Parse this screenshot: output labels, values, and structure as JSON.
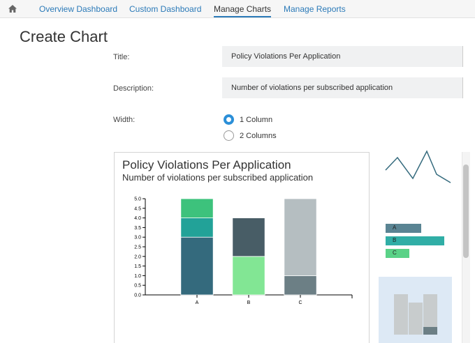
{
  "nav": {
    "home_icon": "home-icon",
    "links": [
      {
        "label": "Overview Dashboard",
        "active": false
      },
      {
        "label": "Custom Dashboard",
        "active": false
      },
      {
        "label": "Manage Charts",
        "active": true
      },
      {
        "label": "Manage Reports",
        "active": false
      }
    ]
  },
  "page_title": "Create Chart",
  "form": {
    "title_label": "Title:",
    "title_value": "Policy Violations Per Application",
    "description_label": "Description:",
    "description_value": "Number of violations per subscribed application",
    "width_label": "Width:",
    "width_options": [
      {
        "label": "1 Column",
        "checked": true
      },
      {
        "label": "2 Columns",
        "checked": false
      }
    ]
  },
  "preview": {
    "title": "Policy Violations Per Application",
    "subtitle": "Number of violations per subscribed application"
  },
  "thumbnails": {
    "bar_labels": [
      "A",
      "B",
      "C"
    ]
  },
  "colors": {
    "accent": "#2b7ab8",
    "radio_checked": "#2b8fd8"
  },
  "chart_data": {
    "type": "bar",
    "stacked": true,
    "categories": [
      "A",
      "B",
      "C"
    ],
    "yticks": [
      "0.0",
      "0.5",
      "1.0",
      "1.5",
      "2.0",
      "2.5",
      "3.0",
      "3.5",
      "4.0",
      "4.5",
      "5.0"
    ],
    "ylim": [
      0,
      5
    ],
    "stacks": [
      [
        {
          "value": 3,
          "color": "#346a7d"
        },
        {
          "value": 1,
          "color": "#22a298"
        },
        {
          "value": 1,
          "color": "#3dc27c"
        }
      ],
      [
        {
          "value": 2,
          "color": "#82e694"
        },
        {
          "value": 2,
          "color": "#485d66"
        }
      ],
      [
        {
          "value": 1,
          "color": "#6c7f85"
        },
        {
          "value": 4,
          "color": "#b5bec1"
        }
      ]
    ]
  }
}
